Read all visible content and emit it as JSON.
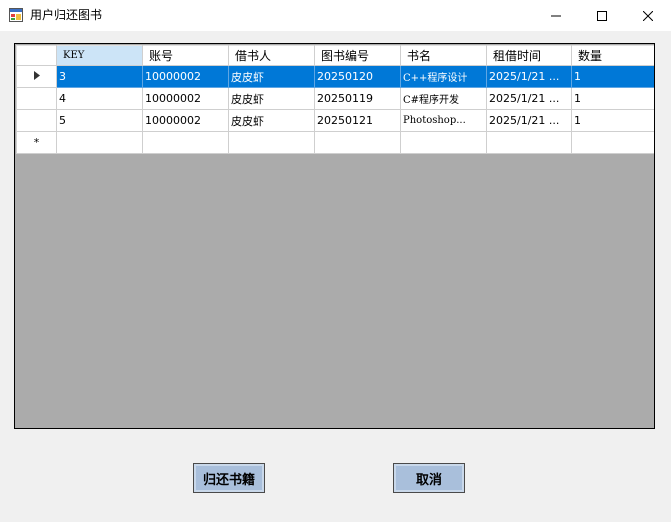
{
  "window": {
    "title": "用户归还图书"
  },
  "grid": {
    "columns": [
      "KEY",
      "账号",
      "借书人",
      "图书编号",
      "书名",
      "租借时间",
      "数量"
    ],
    "rows": [
      [
        "3",
        "10000002",
        "皮皮虾",
        "20250120",
        "C++程序设计",
        "2025/1/21 ...",
        "1"
      ],
      [
        "4",
        "10000002",
        "皮皮虾",
        "20250119",
        "C#程序开发",
        "2025/1/21 ...",
        "1"
      ],
      [
        "5",
        "10000002",
        "皮皮虾",
        "20250121",
        "Photoshop...",
        "2025/1/21 ...",
        "1"
      ]
    ],
    "selected_row": 0,
    "new_row_marker": "*"
  },
  "buttons": {
    "return_label": "归还书籍",
    "cancel_label": "取消"
  },
  "colors": {
    "selection": "#0078d7",
    "grid_background": "#ababab",
    "button": "#a9bfdb"
  }
}
